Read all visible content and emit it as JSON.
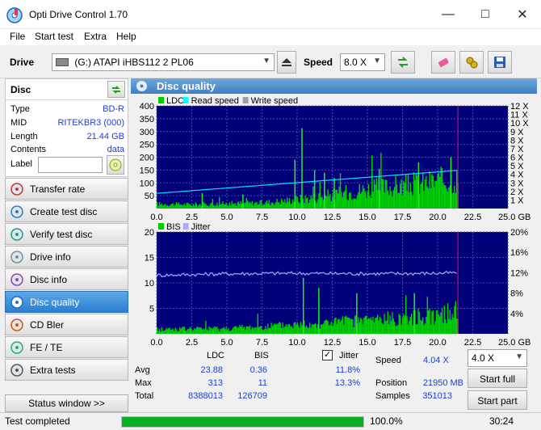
{
  "window": {
    "title": "Opti Drive Control 1.70"
  },
  "menu": [
    "File",
    "Start test",
    "Extra",
    "Help"
  ],
  "toolbar": {
    "drive_label": "Drive",
    "drive_value": "(G:)   ATAPI iHBS112   2 PL06",
    "speed_label": "Speed",
    "speed_value": "8.0 X"
  },
  "disc": {
    "header": "Disc",
    "rows": [
      {
        "key": "Type",
        "value": "BD-R"
      },
      {
        "key": "MID",
        "value": "RITEKBR3 (000)"
      },
      {
        "key": "Length",
        "value": "21.44 GB"
      },
      {
        "key": "Contents",
        "value": "data"
      }
    ],
    "label_key": "Label",
    "label_value": ""
  },
  "nav": [
    {
      "label": "Transfer rate",
      "icon": "transfer-rate-icon"
    },
    {
      "label": "Create test disc",
      "icon": "create-disc-icon"
    },
    {
      "label": "Verify test disc",
      "icon": "verify-disc-icon"
    },
    {
      "label": "Drive info",
      "icon": "drive-info-icon"
    },
    {
      "label": "Disc info",
      "icon": "disc-info-icon"
    },
    {
      "label": "Disc quality",
      "icon": "disc-quality-icon",
      "active": true
    },
    {
      "label": "CD Bler",
      "icon": "cd-bler-icon"
    },
    {
      "label": "FE / TE",
      "icon": "fe-te-icon"
    },
    {
      "label": "Extra tests",
      "icon": "extra-tests-icon"
    }
  ],
  "status_window_label": "Status window >>",
  "panel_title": "Disc quality",
  "chart_data": [
    {
      "type": "bar",
      "legend": [
        "LDC",
        "Read speed",
        "Write speed"
      ],
      "colors": {
        "LDC": "#00cc00",
        "Read speed": "#00ffff",
        "Write speed": "#a0a0a0"
      },
      "xlim": [
        0,
        25
      ],
      "ylim": [
        0,
        400
      ],
      "x_ticks": [
        "0.0",
        "2.5",
        "5.0",
        "7.5",
        "10.0",
        "12.5",
        "15.0",
        "17.5",
        "20.0",
        "22.5",
        "25.0 GB"
      ],
      "y_ticks_left": [
        "400",
        "350",
        "300",
        "250",
        "200",
        "150",
        "100",
        "50"
      ],
      "y_ticks_right": [
        "12 X",
        "11 X",
        "10 X",
        "9 X",
        "8 X",
        "7 X",
        "6 X",
        "5 X",
        "4 X",
        "3 X",
        "2 X",
        "1 X"
      ],
      "disc_end_gb": 21.44,
      "ldc_profile": {
        "x": [
          0,
          2.5,
          5,
          7.5,
          10,
          12.5,
          15,
          17.5,
          20,
          21.44
        ],
        "y": [
          20,
          18,
          22,
          25,
          40,
          60,
          85,
          100,
          120,
          130
        ]
      },
      "ldc_spikes": {
        "x": [
          3.2,
          6.1,
          9.8,
          10.3,
          11.2,
          11.9,
          12.6,
          15.8,
          18.6,
          20.9
        ],
        "y": [
          60,
          55,
          190,
          313,
          150,
          140,
          120,
          155,
          180,
          200
        ]
      },
      "read_speed": {
        "x": [
          0,
          21.44
        ],
        "y": [
          1.85,
          4.65
        ]
      }
    },
    {
      "type": "bar",
      "legend": [
        "BIS",
        "Jitter"
      ],
      "colors": {
        "BIS": "#00cc00",
        "Jitter": "#aaaaff"
      },
      "xlim": [
        0,
        25
      ],
      "ylim": [
        0,
        20
      ],
      "x_ticks": [
        "0.0",
        "2.5",
        "5.0",
        "7.5",
        "10.0",
        "12.5",
        "15.0",
        "17.5",
        "20.0",
        "22.5",
        "25.0 GB"
      ],
      "y_ticks_left": [
        "20",
        "15",
        "10",
        "5"
      ],
      "y_ticks_right": [
        "20%",
        "16%",
        "12%",
        "8%",
        "4%"
      ],
      "disc_end_gb": 21.44,
      "bis_profile": {
        "x": [
          0,
          5,
          10,
          15,
          20,
          21.44
        ],
        "y": [
          1,
          1.2,
          2,
          3,
          4,
          5
        ]
      },
      "bis_spikes": {
        "x": [
          10.4,
          11.5,
          14.2,
          18.3
        ],
        "y": [
          11,
          9,
          8,
          8
        ]
      },
      "jitter_pct": {
        "x": [
          0,
          5,
          10,
          15,
          20,
          21.44
        ],
        "y": [
          11.5,
          11.8,
          11.9,
          11.8,
          11.9,
          12.0
        ]
      }
    }
  ],
  "stats": {
    "col_ldc": "LDC",
    "col_bis": "BIS",
    "jitter_label": "Jitter",
    "rows": [
      {
        "label": "Avg",
        "ldc": "23.88",
        "bis": "0.36",
        "jitter": "11.8%"
      },
      {
        "label": "Max",
        "ldc": "313",
        "bis": "11",
        "jitter": "13.3%"
      },
      {
        "label": "Total",
        "ldc": "8388013",
        "bis": "126709",
        "jitter": ""
      }
    ],
    "speed_label": "Speed",
    "speed_value": "4.04 X",
    "position_label": "Position",
    "position_value": "21950 MB",
    "samples_label": "Samples",
    "samples_value": "351013",
    "speed_select": "4.0 X",
    "start_full": "Start full",
    "start_part": "Start part"
  },
  "status": {
    "text": "Test completed",
    "progress_pct": 100,
    "progress_text": "100.0%",
    "time": "30:24"
  }
}
